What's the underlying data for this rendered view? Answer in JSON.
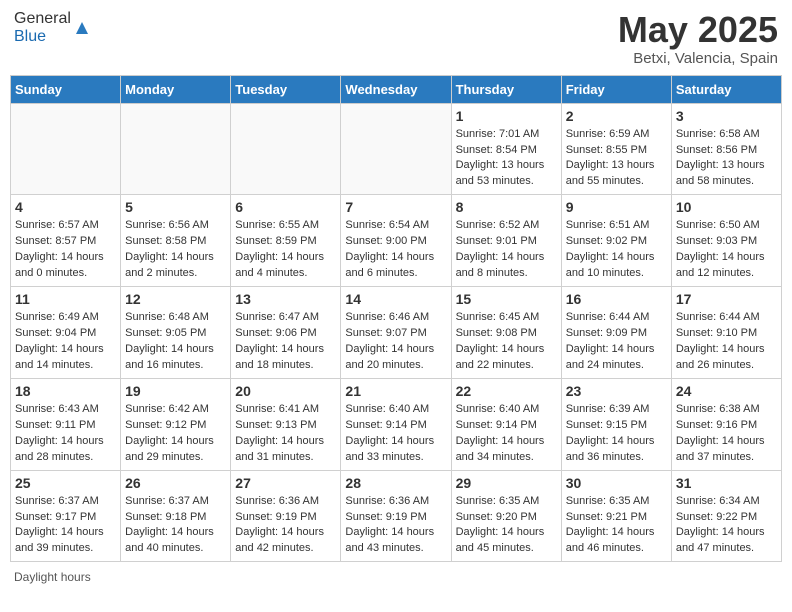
{
  "header": {
    "logo_general": "General",
    "logo_blue": "Blue",
    "month_title": "May 2025",
    "location": "Betxi, Valencia, Spain"
  },
  "days_of_week": [
    "Sunday",
    "Monday",
    "Tuesday",
    "Wednesday",
    "Thursday",
    "Friday",
    "Saturday"
  ],
  "weeks": [
    [
      {
        "day": "",
        "info": ""
      },
      {
        "day": "",
        "info": ""
      },
      {
        "day": "",
        "info": ""
      },
      {
        "day": "",
        "info": ""
      },
      {
        "day": "1",
        "info": "Sunrise: 7:01 AM\nSunset: 8:54 PM\nDaylight: 13 hours\nand 53 minutes."
      },
      {
        "day": "2",
        "info": "Sunrise: 6:59 AM\nSunset: 8:55 PM\nDaylight: 13 hours\nand 55 minutes."
      },
      {
        "day": "3",
        "info": "Sunrise: 6:58 AM\nSunset: 8:56 PM\nDaylight: 13 hours\nand 58 minutes."
      }
    ],
    [
      {
        "day": "4",
        "info": "Sunrise: 6:57 AM\nSunset: 8:57 PM\nDaylight: 14 hours\nand 0 minutes."
      },
      {
        "day": "5",
        "info": "Sunrise: 6:56 AM\nSunset: 8:58 PM\nDaylight: 14 hours\nand 2 minutes."
      },
      {
        "day": "6",
        "info": "Sunrise: 6:55 AM\nSunset: 8:59 PM\nDaylight: 14 hours\nand 4 minutes."
      },
      {
        "day": "7",
        "info": "Sunrise: 6:54 AM\nSunset: 9:00 PM\nDaylight: 14 hours\nand 6 minutes."
      },
      {
        "day": "8",
        "info": "Sunrise: 6:52 AM\nSunset: 9:01 PM\nDaylight: 14 hours\nand 8 minutes."
      },
      {
        "day": "9",
        "info": "Sunrise: 6:51 AM\nSunset: 9:02 PM\nDaylight: 14 hours\nand 10 minutes."
      },
      {
        "day": "10",
        "info": "Sunrise: 6:50 AM\nSunset: 9:03 PM\nDaylight: 14 hours\nand 12 minutes."
      }
    ],
    [
      {
        "day": "11",
        "info": "Sunrise: 6:49 AM\nSunset: 9:04 PM\nDaylight: 14 hours\nand 14 minutes."
      },
      {
        "day": "12",
        "info": "Sunrise: 6:48 AM\nSunset: 9:05 PM\nDaylight: 14 hours\nand 16 minutes."
      },
      {
        "day": "13",
        "info": "Sunrise: 6:47 AM\nSunset: 9:06 PM\nDaylight: 14 hours\nand 18 minutes."
      },
      {
        "day": "14",
        "info": "Sunrise: 6:46 AM\nSunset: 9:07 PM\nDaylight: 14 hours\nand 20 minutes."
      },
      {
        "day": "15",
        "info": "Sunrise: 6:45 AM\nSunset: 9:08 PM\nDaylight: 14 hours\nand 22 minutes."
      },
      {
        "day": "16",
        "info": "Sunrise: 6:44 AM\nSunset: 9:09 PM\nDaylight: 14 hours\nand 24 minutes."
      },
      {
        "day": "17",
        "info": "Sunrise: 6:44 AM\nSunset: 9:10 PM\nDaylight: 14 hours\nand 26 minutes."
      }
    ],
    [
      {
        "day": "18",
        "info": "Sunrise: 6:43 AM\nSunset: 9:11 PM\nDaylight: 14 hours\nand 28 minutes."
      },
      {
        "day": "19",
        "info": "Sunrise: 6:42 AM\nSunset: 9:12 PM\nDaylight: 14 hours\nand 29 minutes."
      },
      {
        "day": "20",
        "info": "Sunrise: 6:41 AM\nSunset: 9:13 PM\nDaylight: 14 hours\nand 31 minutes."
      },
      {
        "day": "21",
        "info": "Sunrise: 6:40 AM\nSunset: 9:14 PM\nDaylight: 14 hours\nand 33 minutes."
      },
      {
        "day": "22",
        "info": "Sunrise: 6:40 AM\nSunset: 9:14 PM\nDaylight: 14 hours\nand 34 minutes."
      },
      {
        "day": "23",
        "info": "Sunrise: 6:39 AM\nSunset: 9:15 PM\nDaylight: 14 hours\nand 36 minutes."
      },
      {
        "day": "24",
        "info": "Sunrise: 6:38 AM\nSunset: 9:16 PM\nDaylight: 14 hours\nand 37 minutes."
      }
    ],
    [
      {
        "day": "25",
        "info": "Sunrise: 6:37 AM\nSunset: 9:17 PM\nDaylight: 14 hours\nand 39 minutes."
      },
      {
        "day": "26",
        "info": "Sunrise: 6:37 AM\nSunset: 9:18 PM\nDaylight: 14 hours\nand 40 minutes."
      },
      {
        "day": "27",
        "info": "Sunrise: 6:36 AM\nSunset: 9:19 PM\nDaylight: 14 hours\nand 42 minutes."
      },
      {
        "day": "28",
        "info": "Sunrise: 6:36 AM\nSunset: 9:19 PM\nDaylight: 14 hours\nand 43 minutes."
      },
      {
        "day": "29",
        "info": "Sunrise: 6:35 AM\nSunset: 9:20 PM\nDaylight: 14 hours\nand 45 minutes."
      },
      {
        "day": "30",
        "info": "Sunrise: 6:35 AM\nSunset: 9:21 PM\nDaylight: 14 hours\nand 46 minutes."
      },
      {
        "day": "31",
        "info": "Sunrise: 6:34 AM\nSunset: 9:22 PM\nDaylight: 14 hours\nand 47 minutes."
      }
    ]
  ],
  "footer": {
    "daylight_hours": "Daylight hours"
  }
}
